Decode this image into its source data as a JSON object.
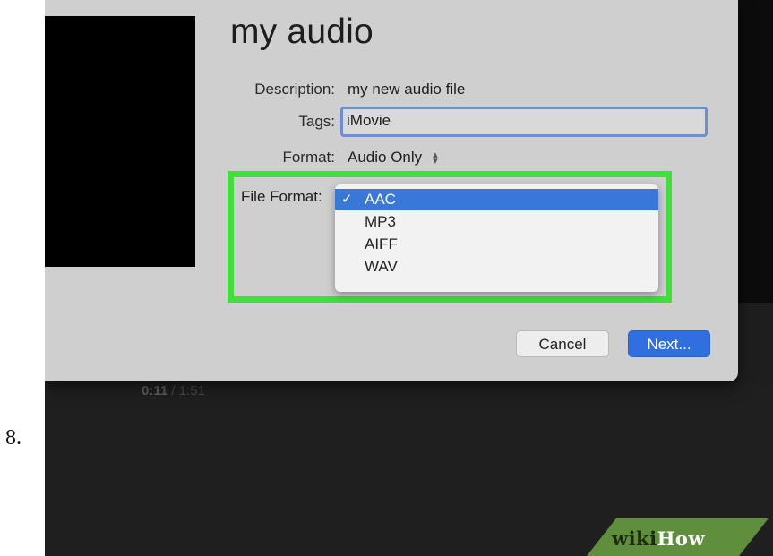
{
  "step_number": "8.",
  "player": {
    "time_current": "0:11",
    "time_separator": " / ",
    "time_total": "1:51"
  },
  "dialog": {
    "title": "my audio",
    "description_label": "Description:",
    "description_value": "my new audio file",
    "tags_label": "Tags:",
    "tags_value": "iMovie",
    "format_label": "Format:",
    "format_value": "Audio Only",
    "format_icon": "up-down-stepper-icon",
    "file_format_label": "File Format:",
    "file_format_options": [
      "AAC",
      "MP3",
      "AIFF",
      "WAV"
    ],
    "file_format_selected": "AAC",
    "cancel_label": "Cancel",
    "next_label": "Next..."
  },
  "highlight_color": "#3fe03b",
  "accent_color": "#2f6fe0",
  "watermark": {
    "part1": "wiki",
    "part2": "How"
  }
}
